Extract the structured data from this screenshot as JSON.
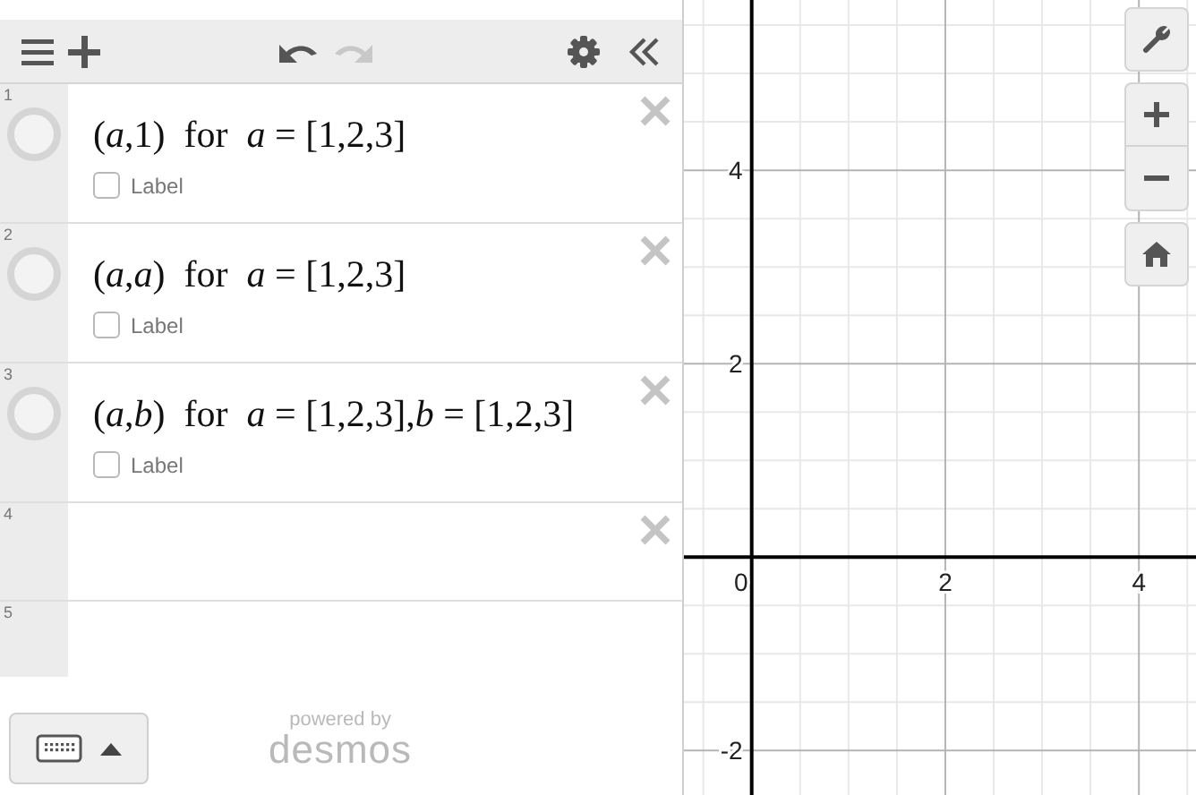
{
  "toolbar": [
    {
      "kind": "menu",
      "disabled": false
    },
    {
      "kind": "add",
      "disabled": false
    },
    {
      "kind": "undo",
      "disabled": false
    },
    {
      "kind": "redo",
      "disabled": true
    },
    {
      "kind": "settings",
      "disabled": false
    },
    {
      "kind": "collapse",
      "disabled": false
    }
  ],
  "expressions": [
    {
      "number": "1",
      "kind": "math",
      "latex": "(*a*,1)  for  *a* = [1,2,3]",
      "label": "Label",
      "label_checked": false
    },
    {
      "number": "2",
      "kind": "math",
      "latex": "(*a*,*a*)  for  *a* = [1,2,3]",
      "label": "Label",
      "label_checked": false
    },
    {
      "number": "3",
      "kind": "math",
      "latex": "(*a*,*b*)  for  *a* = [1,2,3],*b* = [1,2,3]",
      "label": "Label",
      "label_checked": false
    },
    {
      "number": "4",
      "kind": "empty"
    },
    {
      "number": "5",
      "kind": "new"
    }
  ],
  "footer": {
    "powered_by": "powered by",
    "brand": "desmos"
  },
  "graph": {
    "chart_data": {
      "type": "scatter",
      "grid": true,
      "xlim": [
        -0.7,
        4.59
      ],
      "ylim": [
        -2.46,
        5.76
      ],
      "xticks": [
        0,
        2,
        4
      ],
      "yticks": [
        -2,
        2,
        4
      ]
    },
    "controls": [
      {
        "kind": "settings"
      },
      {
        "kind": "zoom_in"
      },
      {
        "kind": "zoom_out"
      },
      {
        "kind": "home"
      }
    ]
  }
}
